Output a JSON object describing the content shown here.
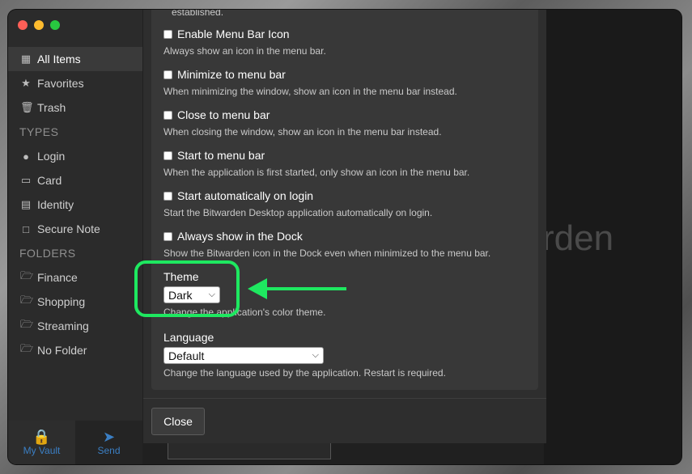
{
  "sidebar": {
    "items": [
      {
        "label": "All Items",
        "icon": "grid-icon",
        "active": true
      },
      {
        "label": "Favorites",
        "icon": "star-icon"
      },
      {
        "label": "Trash",
        "icon": "trash-icon"
      }
    ],
    "types_heading": "TYPES",
    "types": [
      {
        "label": "Login",
        "icon": "globe-icon"
      },
      {
        "label": "Card",
        "icon": "credit-card-icon"
      },
      {
        "label": "Identity",
        "icon": "id-card-icon"
      },
      {
        "label": "Secure Note",
        "icon": "note-icon"
      }
    ],
    "folders_heading": "FOLDERS",
    "folders": [
      {
        "label": "Finance",
        "icon": "folder-icon"
      },
      {
        "label": "Shopping",
        "icon": "folder-icon"
      },
      {
        "label": "Streaming",
        "icon": "folder-icon"
      },
      {
        "label": "No Folder",
        "icon": "folder-icon"
      }
    ],
    "bottom": {
      "vault_label": "My Vault",
      "send_label": "Send"
    }
  },
  "background": {
    "brand_fragment": "rden"
  },
  "settings": {
    "clipped_text": "established.",
    "options": [
      {
        "label": "Enable Menu Bar Icon",
        "description": "Always show an icon in the menu bar.",
        "checked": false
      },
      {
        "label": "Minimize to menu bar",
        "description": "When minimizing the window, show an icon in the menu bar instead.",
        "checked": false
      },
      {
        "label": "Close to menu bar",
        "description": "When closing the window, show an icon in the menu bar instead.",
        "checked": false
      },
      {
        "label": "Start to menu bar",
        "description": "When the application is first started, only show an icon in the menu bar.",
        "checked": false
      },
      {
        "label": "Start automatically on login",
        "description": "Start the Bitwarden Desktop application automatically on login.",
        "checked": false
      },
      {
        "label": "Always show in the Dock",
        "description": "Show the Bitwarden icon in the Dock even when minimized to the menu bar.",
        "checked": false
      }
    ],
    "theme": {
      "label": "Theme",
      "value": "Dark",
      "description": "Change the application's color theme."
    },
    "language": {
      "label": "Language",
      "value": "Default",
      "description": "Change the language used by the application. Restart is required."
    },
    "close_label": "Close"
  },
  "colors": {
    "accent": "#3b7fc4",
    "highlight": "#1ee860"
  }
}
